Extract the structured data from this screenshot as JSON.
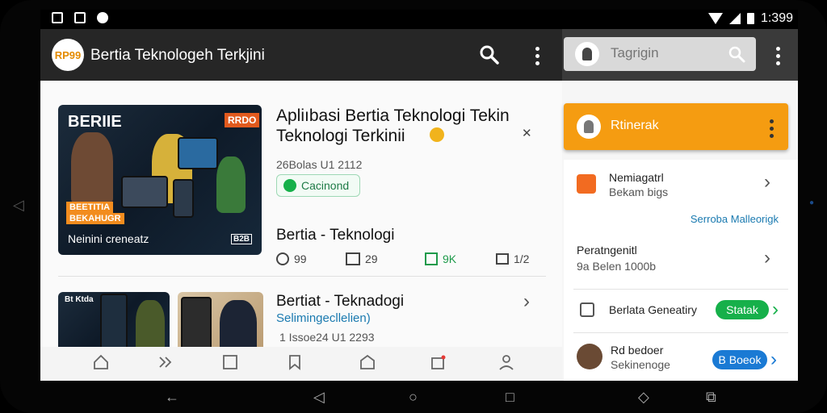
{
  "status_bar": {
    "time": "1:399"
  },
  "app_bar": {
    "logo_text": "RP99",
    "title": "Bertia Teknologeh Terkjini"
  },
  "right_panel": {
    "search_placeholder": "Tagrigin",
    "orange_card_label": "Rtinerak",
    "items": [
      {
        "title": "Nemiagatrl",
        "subtitle": "Bekam bigs"
      },
      {
        "link": "Serroba Malleorigk"
      },
      {
        "title": "Peratngenitl",
        "subtitle": "9a Belen 1000b"
      },
      {
        "title": "Berlata Geneatiry",
        "pill": "Statak"
      },
      {
        "title": "Rd bedoer",
        "subtitle": "Sekinenoge",
        "pill": "B Boeok"
      }
    ]
  },
  "featured": {
    "thumb_top_label": "BERIIE",
    "thumb_top_right": "RRDO",
    "thumb_orange_label_1": "BEETITIA",
    "thumb_orange_label_2": "BEKAHUGR",
    "thumb_caption": "Neinini creneatz",
    "thumb_corner": "B2B",
    "title_line1": "Apliıbasi Bertia Teknologi Tekin",
    "title_line2": "Teknologi Terkinii",
    "date": "26Bolas U1 2112",
    "badge": "Cacinond",
    "category": "Bertia - Teknologi",
    "stats": {
      "views": "99",
      "shares": "29",
      "likes": "9K",
      "comments": "1/2"
    }
  },
  "second": {
    "thumb1_label": "Bt Ktda",
    "title": "Bertiat - Teknadogi",
    "subtitle": "Selimingecllelien)",
    "date": "1 Issoe24 U1 2293"
  },
  "colors": {
    "accent_orange": "#f59c11",
    "green": "#16b04a",
    "blue": "#1a7ad4",
    "link_blue": "#1a7ab0"
  }
}
